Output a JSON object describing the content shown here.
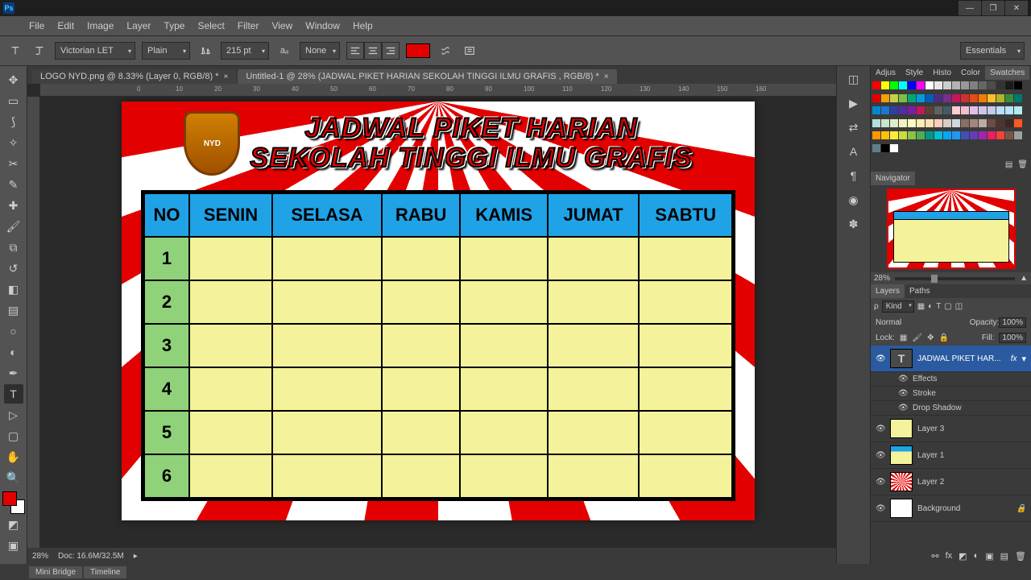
{
  "app": {
    "logo_text": "Ps"
  },
  "window_controls": {
    "minimize": "—",
    "restore": "❐",
    "close": "✕"
  },
  "menu": [
    "File",
    "Edit",
    "Image",
    "Layer",
    "Type",
    "Select",
    "Filter",
    "View",
    "Window",
    "Help"
  ],
  "options_bar": {
    "font_family": "Victorian LET",
    "font_style": "Plain",
    "font_size": "215 pt",
    "anti_alias": "None",
    "color_hex": "#e30000"
  },
  "workspace": "Essentials",
  "doc_tabs": [
    {
      "label": "LOGO NYD.png @ 8.33% (Layer 0, RGB/8) *",
      "active": false
    },
    {
      "label": "Untitled-1 @ 28% (JADWAL PIKET HARIAN SEKOLAH TINGGI ILMU GRAFIS , RGB/8) *",
      "active": true
    }
  ],
  "ruler_marks": [
    "0",
    "10",
    "20",
    "30",
    "40",
    "50",
    "60",
    "70",
    "80",
    "90",
    "100",
    "110",
    "120",
    "130",
    "140",
    "150",
    "160"
  ],
  "canvas": {
    "title_line1": "JADWAL PIKET HARIAN",
    "title_line2": "SEKOLAH TINGGI ILMU GRAFIS",
    "shield_text": "NYD",
    "headers": [
      "NO",
      "SENIN",
      "SELASA",
      "RABU",
      "KAMIS",
      "JUMAT",
      "SABTU"
    ],
    "rows": [
      "1",
      "2",
      "3",
      "4",
      "5",
      "6"
    ]
  },
  "status_bar": {
    "zoom": "28%",
    "doc_info": "Doc: 16.6M/32.5M"
  },
  "bottom_tabs": [
    "Mini Bridge",
    "Timeline"
  ],
  "panels": {
    "color_tabs": [
      "Adjus",
      "Style",
      "Histo",
      "Color",
      "Swatches"
    ],
    "swatch_colors": [
      "#ff0000",
      "#ffff00",
      "#00ff00",
      "#00ffff",
      "#0000ff",
      "#ff00ff",
      "#ffffff",
      "#e6e6e6",
      "#cccccc",
      "#b3b3b3",
      "#999999",
      "#808080",
      "#666666",
      "#4d4d4d",
      "#333333",
      "#1a1a1a",
      "#000000",
      "#e30000",
      "#f4a000",
      "#c2d04a",
      "#7bc043",
      "#00a878",
      "#009ddc",
      "#005eb8",
      "#4b2e83",
      "#7b2d8e",
      "#c2185b",
      "#d32f2f",
      "#e64a19",
      "#f57c00",
      "#fbc02d",
      "#afb42b",
      "#388e3c",
      "#00796b",
      "#0288d1",
      "#1976d2",
      "#303f9f",
      "#512da8",
      "#7b1fa2",
      "#c2185b",
      "#5d4037",
      "#616161",
      "#455a64",
      "#ffcdd2",
      "#f8bbd0",
      "#e1bee7",
      "#d1c4e9",
      "#c5cae9",
      "#bbdefb",
      "#b3e5fc",
      "#b2ebf2",
      "#b2dfdb",
      "#c8e6c9",
      "#dcedc8",
      "#f0f4c3",
      "#fff9c4",
      "#ffecb3",
      "#ffe0b2",
      "#ffccbc",
      "#d7ccc8",
      "#cfd8dc",
      "#8d6e63",
      "#a1887f",
      "#bcaaa4",
      "#6d4c41",
      "#4e342e",
      "#3e2723",
      "#ff5722",
      "#ff9800",
      "#ffc107",
      "#ffeb3b",
      "#cddc39",
      "#8bc34a",
      "#4caf50",
      "#009688",
      "#00bcd4",
      "#03a9f4",
      "#2196f3",
      "#3f51b5",
      "#673ab7",
      "#9c27b0",
      "#e91e63",
      "#f44336",
      "#795548",
      "#9e9e9e",
      "#607d8b",
      "#000000",
      "#ffffff"
    ],
    "navigator": {
      "title": "Navigator",
      "zoom": "28%"
    },
    "layers": {
      "tabs": [
        "Layers",
        "Paths"
      ],
      "kind_label": "Kind",
      "blend_mode": "Normal",
      "opacity_label": "Opacity:",
      "opacity_value": "100%",
      "lock_label": "Lock:",
      "fill_label": "Fill:",
      "fill_value": "100%",
      "items": [
        {
          "name": "JADWAL PIKET HAR...",
          "type": "T",
          "active": true,
          "fx": "fx",
          "effects": [
            "Effects",
            "Stroke",
            "Drop Shadow"
          ]
        },
        {
          "name": "Layer 3",
          "type": "img",
          "thumb": "#f4f29a"
        },
        {
          "name": "Layer 1",
          "type": "img",
          "thumb": "#1fa2e6"
        },
        {
          "name": "Layer 2",
          "type": "img",
          "thumb": "#e30000"
        },
        {
          "name": "Background",
          "type": "img",
          "thumb": "#ffffff",
          "locked": true
        }
      ]
    }
  }
}
